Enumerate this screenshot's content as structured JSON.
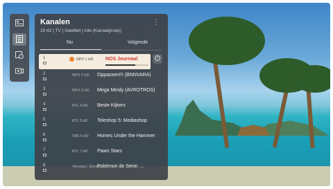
{
  "panel": {
    "title": "Kanalen",
    "subtitle": "15:42 | TV | Satelliet | Alle (Kanaalgroep)",
    "more_icon": "⋮"
  },
  "tabs": {
    "now": "Nu",
    "next": "Volgende"
  },
  "sidebar": [
    "tv-guide-icon",
    "channel-list-icon",
    "schedule-icon",
    "recordings-icon"
  ],
  "channels": [
    {
      "num": "1",
      "channel": "NPO 1 HD",
      "program": "NOS Journaal",
      "progress": 0.7,
      "selected": true
    },
    {
      "num": "2",
      "channel": "NPO 2 HD",
      "program": "Oppassen!!! (BNNVARA)"
    },
    {
      "num": "3",
      "channel": "NPO 3 HD",
      "program": "Mega Mindy (AVROTROS)"
    },
    {
      "num": "4",
      "channel": "RTL 4 HD",
      "program": "Beste Kijkers"
    },
    {
      "num": "5",
      "channel": "RTL 5 HD",
      "program": "Teleshop 5: Mediashop"
    },
    {
      "num": "6",
      "channel": "SBS 6 HD",
      "program": "Homes Under the Hammer"
    },
    {
      "num": "7",
      "channel": "RTL 7 HD",
      "program": "Pawn Stars"
    },
    {
      "num": "8",
      "channel": "Veronica / Disney...",
      "program": "Pokémon de Serie: ..."
    }
  ]
}
